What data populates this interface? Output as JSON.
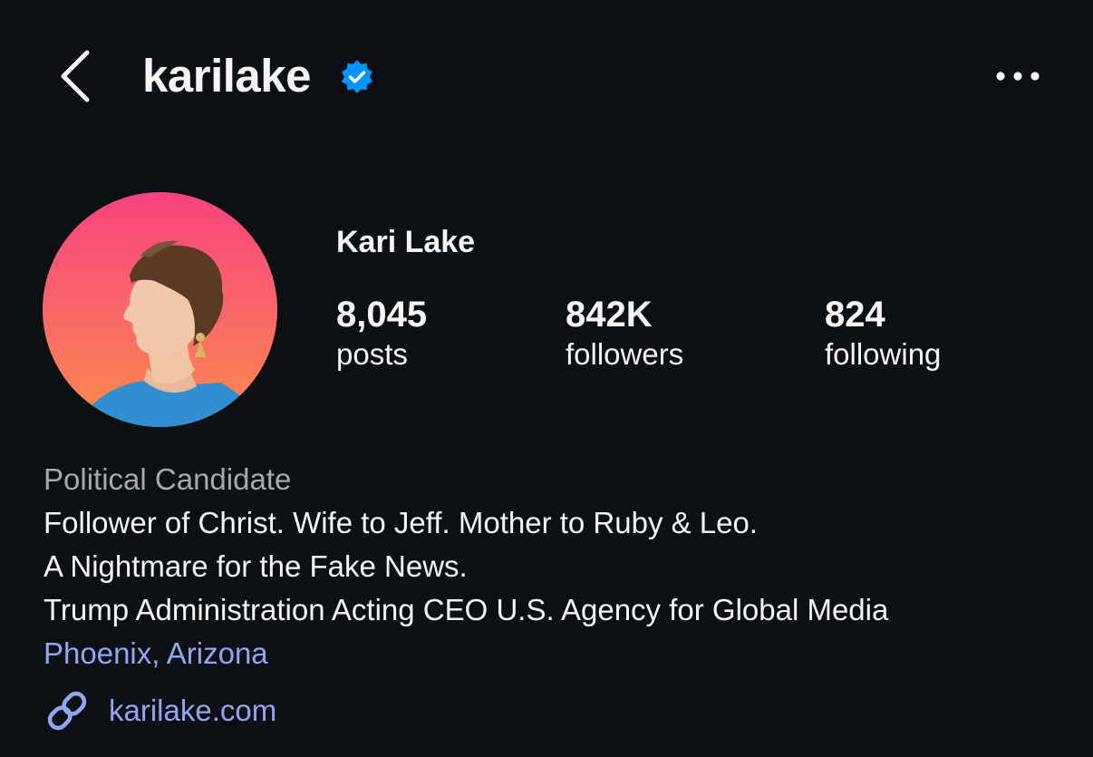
{
  "header": {
    "username": "karilake",
    "back_icon": "chevron-left-icon",
    "verified_icon": "verified-badge-icon",
    "more_icon": "ellipsis-horizontal-icon"
  },
  "profile": {
    "display_name": "Kari Lake",
    "stats": [
      {
        "value": "8,045",
        "label": "posts"
      },
      {
        "value": "842K",
        "label": "followers"
      },
      {
        "value": "824",
        "label": "following"
      }
    ]
  },
  "bio": {
    "category": "Political Candidate",
    "lines": [
      "Follower of Christ. Wife to Jeff. Mother to Ruby & Leo.",
      "A Nightmare for the Fake News.",
      "Trump Administration Acting CEO U.S. Agency for Global Media"
    ],
    "location": "Phoenix, Arizona"
  },
  "link": {
    "icon": "link-icon",
    "text": "karilake.com"
  },
  "colors": {
    "background": "#0c1014",
    "text": "#f5f5f5",
    "muted": "#a8a8a8",
    "link": "#8fa7f0",
    "verified": "#0095f6",
    "avatar_gradient_top": "#f7437f",
    "avatar_gradient_bottom": "#fc8c4c"
  }
}
